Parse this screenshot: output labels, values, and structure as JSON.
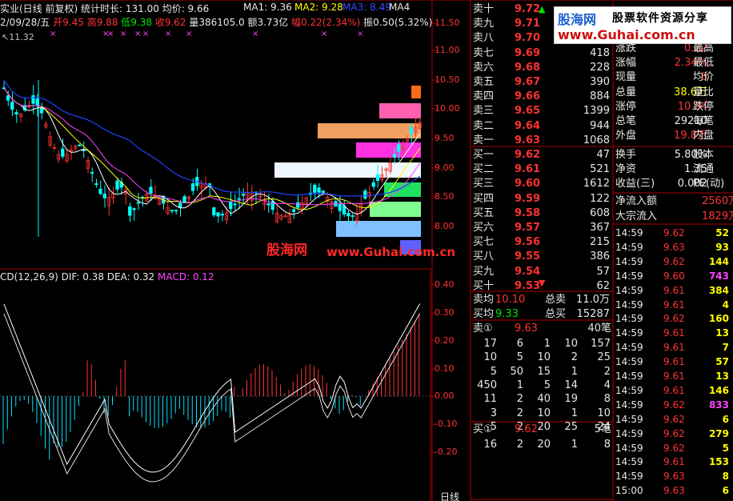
{
  "header": {
    "title": "实业(日线 前复权)",
    "stat_label": "统计时长: 131.00",
    "avg_label": "均价: 9.66",
    "ma1": "MA1: 9.36",
    "ma2": "MA2: 9.28",
    "ma3": "MA3: 8.49",
    "ma4": "MA4",
    "date": "2/09/28/五",
    "open": "开9.45",
    "high": "高9.88",
    "low": "低9.38",
    "close": "收9.62",
    "volume": "量386105.0",
    "amount": "额3.73亿",
    "change": "幅0.22(2.34%)",
    "amplitude": "振0.50(5.32%)",
    "swap": "换",
    "start_price": "11.32"
  },
  "price_axis": [
    "11.50",
    "11.00",
    "10.50",
    "10.00",
    "9.50",
    "9.00",
    "8.50",
    "8.00"
  ],
  "macd": {
    "label": "CD(12,26,9)",
    "dif": "DIF: 0.38",
    "dea": "DEA: 0.32",
    "macd": "MACD: 0.12",
    "axis": [
      "0.40",
      "0.30",
      "0.20",
      "0.10",
      "0.00",
      "-0.10",
      "-0.20"
    ]
  },
  "bottom_label": "日线",
  "watermark": {
    "cn": "股海网",
    "url": "www.Guhai.com.cn"
  },
  "logo": {
    "brand": "股海网",
    "slogan": "股票软件资源分享",
    "url": "www.Guhai.com.cn"
  },
  "order_book": {
    "sell": [
      {
        "label": "卖十",
        "price": "9.72",
        "vol": "",
        "color": "#ff3232"
      },
      {
        "label": "卖九",
        "price": "9.71",
        "vol": "",
        "color": "#ff3232"
      },
      {
        "label": "卖八",
        "price": "9.70",
        "vol": "",
        "color": "#ff3232"
      },
      {
        "label": "卖七",
        "price": "9.69",
        "vol": "418",
        "color": "#ff3232"
      },
      {
        "label": "卖六",
        "price": "9.68",
        "vol": "228",
        "color": "#ff3232"
      },
      {
        "label": "卖五",
        "price": "9.67",
        "vol": "390",
        "color": "#ff3232"
      },
      {
        "label": "卖四",
        "price": "9.66",
        "vol": "884",
        "color": "#ff3232"
      },
      {
        "label": "卖三",
        "price": "9.65",
        "vol": "1399",
        "color": "#ff3232"
      },
      {
        "label": "卖二",
        "price": "9.64",
        "vol": "944",
        "color": "#ff3232"
      },
      {
        "label": "卖一",
        "price": "9.63",
        "vol": "1068",
        "color": "#ff3232"
      }
    ],
    "buy": [
      {
        "label": "买一",
        "price": "9.62",
        "vol": "47",
        "color": "#ff3232"
      },
      {
        "label": "买二",
        "price": "9.61",
        "vol": "521",
        "color": "#ff3232"
      },
      {
        "label": "买三",
        "price": "9.60",
        "vol": "1612",
        "color": "#ff3232"
      },
      {
        "label": "买四",
        "price": "9.59",
        "vol": "122",
        "color": "#ff3232"
      },
      {
        "label": "买五",
        "price": "9.58",
        "vol": "608",
        "color": "#ff3232"
      },
      {
        "label": "买六",
        "price": "9.57",
        "vol": "367",
        "color": "#ff3232"
      },
      {
        "label": "买七",
        "price": "9.56",
        "vol": "215",
        "color": "#ff3232"
      },
      {
        "label": "买八",
        "price": "9.55",
        "vol": "386",
        "color": "#ff3232"
      },
      {
        "label": "买九",
        "price": "9.54",
        "vol": "57",
        "color": "#ff3232"
      },
      {
        "label": "买十",
        "price": "9.53",
        "vol": "62",
        "color": "#ff3232"
      }
    ],
    "sell_avg_label": "卖均",
    "sell_avg": "10.10",
    "total_sell_label": "总卖",
    "total_sell": "11.0万",
    "buy_avg_label": "买均",
    "buy_avg": "9.33",
    "total_buy_label": "总买",
    "total_buy": "15287"
  },
  "queue_sell": {
    "label": "卖①",
    "price": "9.63",
    "count": "40笔",
    "rows": [
      [
        "17",
        "6",
        "1",
        "10",
        "157"
      ],
      [
        "10",
        "5",
        "10",
        "2",
        "25"
      ],
      [
        "5",
        "50",
        "15",
        "1",
        "2"
      ],
      [
        "450",
        "1",
        "5",
        "14",
        "4"
      ],
      [
        "11",
        "2",
        "40",
        "19",
        "8"
      ],
      [
        "3",
        "2",
        "10",
        "1",
        "10"
      ],
      [
        "5",
        "2",
        "20",
        "25",
        "24"
      ]
    ]
  },
  "queue_buy": {
    "label": "买①",
    "price": "9.62",
    "count": "5笔",
    "rows": [
      [
        "16",
        "2",
        "20",
        "1",
        "8"
      ]
    ]
  },
  "quote": [
    {
      "label": "涨跌",
      "value": "0.22",
      "vcolor": "#ff3232",
      "label2": "最高"
    },
    {
      "label": "涨幅",
      "value": "2.34%",
      "vcolor": "#ff3232",
      "label2": "最低"
    },
    {
      "label": "现量",
      "value": "6",
      "vcolor": "#ff3232",
      "label2": "均价"
    },
    {
      "label": "总量",
      "value": "38.6万",
      "vcolor": "#ffff00",
      "label2": "量比"
    },
    {
      "label": "涨停",
      "value": "10.34",
      "vcolor": "#ff3232",
      "label2": "跌停"
    },
    {
      "label": "总笔",
      "value": "29210",
      "vcolor": "#e8e8e8",
      "label2": "每笔"
    },
    {
      "label": "外盘",
      "value": "19.8万",
      "vcolor": "#ff3232",
      "label2": "内盘"
    },
    {
      "label": "换手",
      "value": "5.80%",
      "vcolor": "#e8e8e8",
      "label2": "股本"
    },
    {
      "label": "净资",
      "value": "1.35",
      "vcolor": "#e8e8e8",
      "label2": "流通"
    },
    {
      "label": "收益(三)",
      "value": "0.002",
      "vcolor": "#e8e8e8",
      "label2": "PE(动)"
    }
  ],
  "flows": [
    {
      "label": "净流入额",
      "value": "2560万",
      "vcolor": "#ff3232"
    },
    {
      "label": "大宗流入",
      "value": "1829万",
      "vcolor": "#ff3232"
    }
  ],
  "ticks": [
    {
      "time": "14:59",
      "price": "9.62",
      "vol": "52",
      "vcolor": "#ffff00"
    },
    {
      "time": "14:59",
      "price": "9.63",
      "vol": "93",
      "vcolor": "#ffff00"
    },
    {
      "time": "14:59",
      "price": "9.62",
      "vol": "144",
      "vcolor": "#ffff00"
    },
    {
      "time": "14:59",
      "price": "9.60",
      "vol": "743",
      "vcolor": "#ff44ff"
    },
    {
      "time": "14:59",
      "price": "9.61",
      "vol": "384",
      "vcolor": "#ffff00"
    },
    {
      "time": "14:59",
      "price": "9.61",
      "vol": "4",
      "vcolor": "#ffff00"
    },
    {
      "time": "14:59",
      "price": "9.62",
      "vol": "160",
      "vcolor": "#ffff00"
    },
    {
      "time": "14:59",
      "price": "9.61",
      "vol": "13",
      "vcolor": "#ffff00"
    },
    {
      "time": "14:59",
      "price": "9.61",
      "vol": "7",
      "vcolor": "#ffff00"
    },
    {
      "time": "14:59",
      "price": "9.61",
      "vol": "57",
      "vcolor": "#ffff00"
    },
    {
      "time": "14:59",
      "price": "9.61",
      "vol": "13",
      "vcolor": "#ffff00"
    },
    {
      "time": "14:59",
      "price": "9.61",
      "vol": "146",
      "vcolor": "#ffff00"
    },
    {
      "time": "14:59",
      "price": "9.62",
      "vol": "833",
      "vcolor": "#ff44ff"
    },
    {
      "time": "14:59",
      "price": "9.62",
      "vol": "6",
      "vcolor": "#ffff00"
    },
    {
      "time": "14:59",
      "price": "9.62",
      "vol": "279",
      "vcolor": "#ffff00"
    },
    {
      "time": "14:59",
      "price": "9.62",
      "vol": "5",
      "vcolor": "#ffff00"
    },
    {
      "time": "14:59",
      "price": "9.61",
      "vol": "153",
      "vcolor": "#ffff00"
    },
    {
      "time": "14:59",
      "price": "9.63",
      "vol": "8",
      "vcolor": "#ffff00"
    },
    {
      "time": "15:00",
      "price": "9.63",
      "vol": "6",
      "vcolor": "#ffff00"
    }
  ],
  "colors": {
    "up": "#ff3232",
    "down": "#00ffff",
    "bg": "#000000",
    "frame": "#b00000"
  }
}
